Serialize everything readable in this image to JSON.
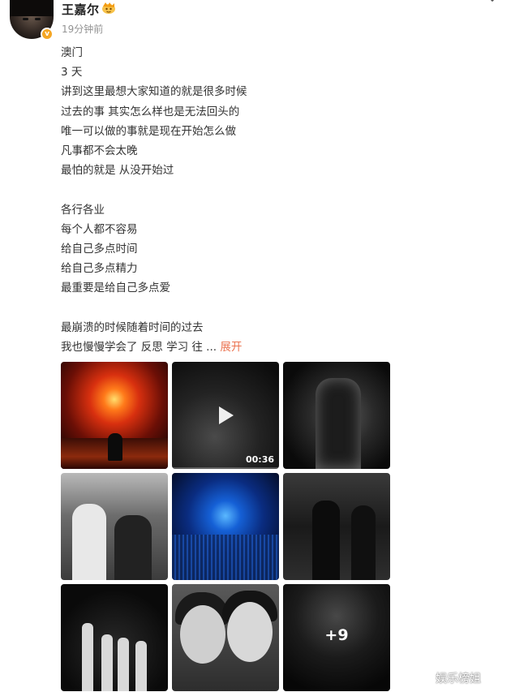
{
  "author": {
    "name": "王嘉尔",
    "timestamp": "19分钟前",
    "verified_icon": "verified-v-icon",
    "badge_icon": "fan-badge-icon"
  },
  "post": {
    "lines": [
      "澳门",
      "3 天",
      "讲到这里最想大家知道的就是很多时候",
      "过去的事 其实怎么样也是无法回头的",
      "唯一可以做的事就是现在开始怎么做",
      "凡事都不会太晚",
      "最怕的就是 从没开始过",
      "",
      "各行各业",
      "每个人都不容易",
      "给自己多点时间",
      "给自己多点精力",
      "最重要是给自己多点爱",
      "",
      "最崩溃的时候随着时间的过去"
    ],
    "last_line": "我也慢慢学会了 反思 学习 往 ...",
    "expand_label": "展开"
  },
  "media": {
    "video_duration": "00:36",
    "more_count": "+9"
  },
  "watermark": {
    "text": "娱乐榜姐",
    "icon": "weibo-logo-icon"
  },
  "colors": {
    "accent": "#eb7350",
    "verified": "#f5a623",
    "text": "#333333",
    "muted": "#939393"
  }
}
